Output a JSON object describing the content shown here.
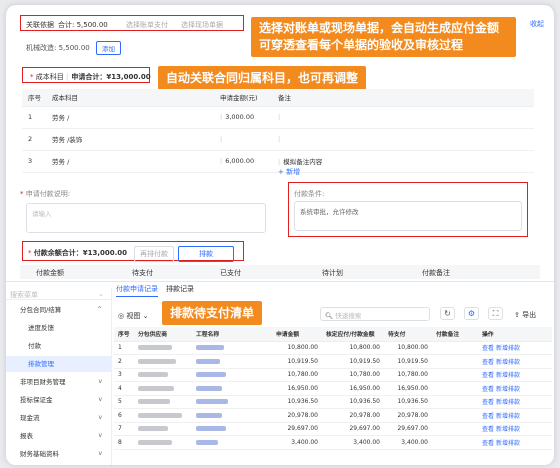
{
  "header": {
    "basis_label": "关联依据",
    "total_label": "合计: 5,500.00",
    "select_bill_btn": "选择账单支付",
    "select_site_btn": "选择现场单据",
    "mech_fee_label": "机械改造: 5,500.00",
    "add_btn": "添加",
    "top_right_link": "收起"
  },
  "callouts": {
    "c1": "选择对账单或现场单据，会自动生成应付金额可穿透查看每个单据的验收及审核过程",
    "c2": "自动关联合同归属科目，也可再调整",
    "c3": "排款待支付清单"
  },
  "cost": {
    "section_label": "成本科目",
    "total_label": "申请合计：¥13,000.00",
    "columns": [
      "序号",
      "成本科目",
      "申请金额(元)",
      "备注"
    ],
    "rows": [
      {
        "no": "1",
        "subject": "劳务  /",
        "amount": "3,000.00",
        "note": ""
      },
      {
        "no": "2",
        "subject": "劳务  /装饰",
        "amount": "",
        "note": ""
      },
      {
        "no": "3",
        "subject": "劳务  /",
        "amount": "6,000.00",
        "note": "模拟备注内容"
      }
    ],
    "add_link": "+ 新增"
  },
  "form": {
    "desc_label": "申请付款说明:",
    "desc_placeholder": "请输入",
    "cond_label": "付款条件:",
    "cond_value": "系统审批，允许修改"
  },
  "remain": {
    "label": "付款余额合计：¥13,000.00",
    "tab_pending": "再排付款",
    "tab_schedule": "排款"
  },
  "pay_table_header": [
    "付款金额",
    "待支付",
    "已支付",
    "待计划",
    "付款备注"
  ],
  "sidebar": {
    "search_placeholder": "搜索菜单",
    "items": [
      {
        "label": "分包合同/结算",
        "group": true,
        "chev": "^"
      },
      {
        "label": "进度反馈",
        "group": false
      },
      {
        "label": "付款",
        "group": false
      },
      {
        "label": "排款管理",
        "group": false,
        "active": true
      },
      {
        "label": "非项目财务管理",
        "group": true,
        "chev": "v"
      },
      {
        "label": "投标保证金",
        "group": true,
        "chev": "v"
      },
      {
        "label": "现金流",
        "group": true,
        "chev": "v"
      },
      {
        "label": "报表",
        "group": true,
        "chev": "v"
      },
      {
        "label": "财务基础资料",
        "group": true,
        "chev": "v"
      }
    ]
  },
  "subtabs": [
    "付款申请记录",
    "排款记录"
  ],
  "toolbar": {
    "view_label": "视图",
    "search_placeholder": "快速搜索",
    "export_label": "导出"
  },
  "list": {
    "columns": [
      "序号",
      "分包供应商",
      "工程名称",
      "申请金额",
      "核定应付/付款金额",
      "待支付",
      "付款备注",
      "操作"
    ],
    "rows": [
      {
        "no": "1",
        "amount": "10,800.00",
        "approved": "10,800.00",
        "pending": "10,800.00"
      },
      {
        "no": "2",
        "amount": "10,919.50",
        "approved": "10,919.50",
        "pending": "10,919.50"
      },
      {
        "no": "3",
        "amount": "10,780.00",
        "approved": "10,780.00",
        "pending": "10,780.00"
      },
      {
        "no": "4",
        "amount": "16,950.00",
        "approved": "16,950.00",
        "pending": "16,950.00"
      },
      {
        "no": "5",
        "amount": "10,936.50",
        "approved": "10,936.50",
        "pending": "10,936.50"
      },
      {
        "no": "6",
        "amount": "20,978.00",
        "approved": "20,978.00",
        "pending": "20,978.00"
      },
      {
        "no": "7",
        "amount": "29,697.00",
        "approved": "29,697.00",
        "pending": "29,697.00"
      },
      {
        "no": "8",
        "amount": "3,400.00",
        "approved": "3,400.00",
        "pending": "3,400.00"
      }
    ],
    "action_view": "查看",
    "action_add": "新增排款"
  },
  "colors": {
    "accent": "#2f6bff",
    "callout": "#f28a1e",
    "highlight": "#e02020"
  }
}
